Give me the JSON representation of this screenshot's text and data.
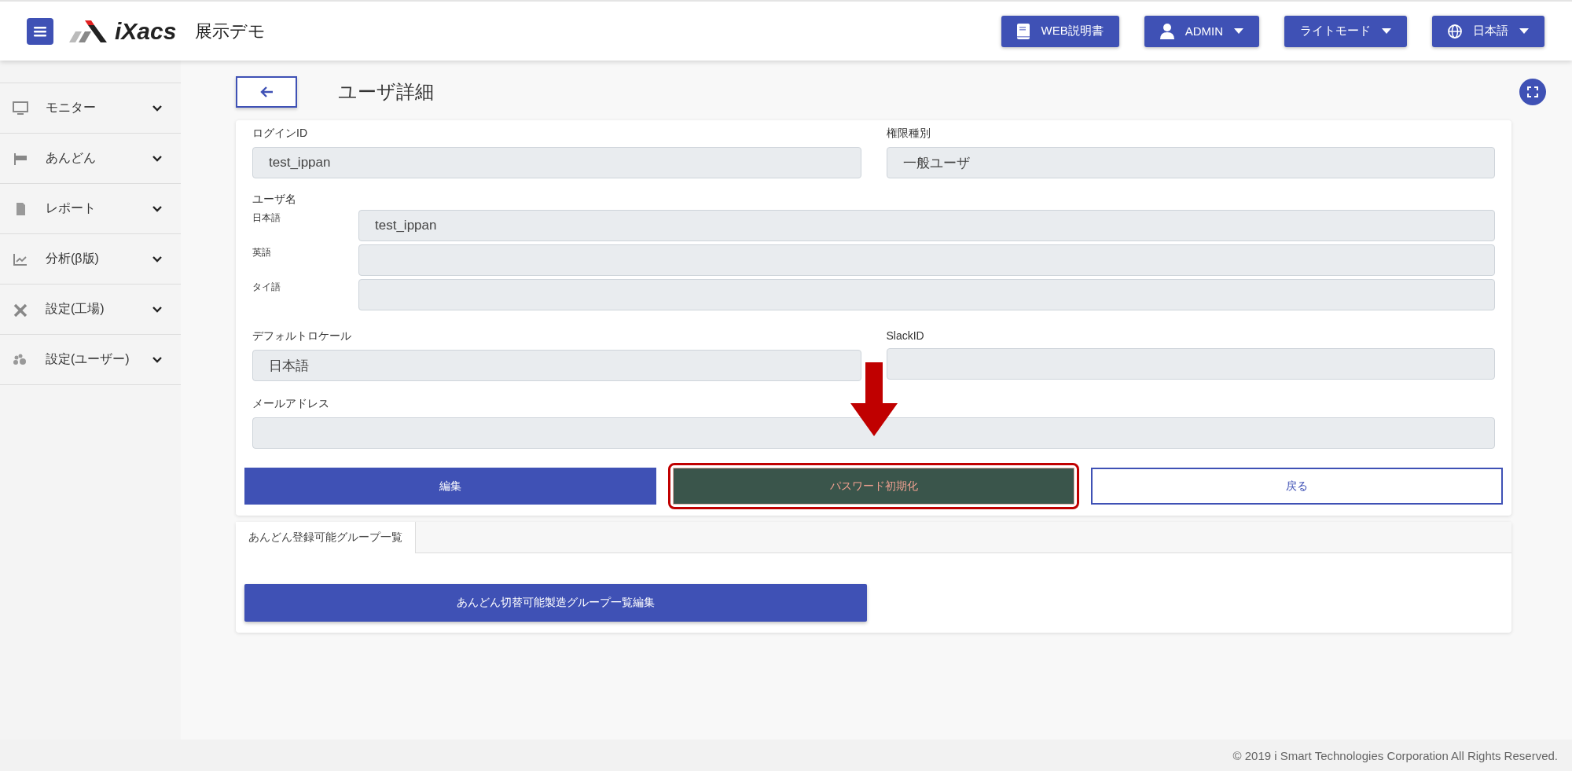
{
  "header": {
    "logo_text": "iXacs",
    "site_name": "展示デモ",
    "buttons": [
      {
        "label": "WEB説明書",
        "kind": "manual",
        "dropdown": false
      },
      {
        "label": "ADMIN",
        "kind": "user",
        "dropdown": true
      },
      {
        "label": "ライトモード",
        "kind": "theme",
        "dropdown": true
      },
      {
        "label": "日本語",
        "kind": "language",
        "dropdown": true
      }
    ]
  },
  "sidebar": {
    "items": [
      {
        "label": "モニター",
        "kind": "monitor"
      },
      {
        "label": "あんどん",
        "kind": "flag"
      },
      {
        "label": "レポート",
        "kind": "report"
      },
      {
        "label": "分析(β版)",
        "kind": "chart"
      },
      {
        "label": "設定(工場)",
        "kind": "tools"
      },
      {
        "label": "設定(ユーザー)",
        "kind": "users"
      }
    ]
  },
  "page": {
    "title": "ユーザ詳細"
  },
  "form": {
    "login_id": {
      "label": "ログインID",
      "value": "test_ippan"
    },
    "role": {
      "label": "権限種別",
      "value": "一般ユーザ"
    },
    "user_name": {
      "label": "ユーザ名",
      "languages": [
        {
          "label": "日本語",
          "value": "test_ippan"
        },
        {
          "label": "英語"
        },
        {
          "label": "タイ語"
        }
      ]
    },
    "locale": {
      "label": "デフォルトロケール",
      "value": "日本語"
    },
    "slack_id": {
      "label": "SlackID"
    },
    "email": {
      "label": "メールアドレス"
    },
    "buttons": [
      {
        "label": "編集",
        "kind": "primary",
        "annotated": false
      },
      {
        "label": "パスワード初期化",
        "kind": "dark",
        "annotated": true
      },
      {
        "label": "戻る",
        "kind": "outline",
        "annotated": false
      }
    ]
  },
  "groups": {
    "tabs": [
      {
        "label": "あんどん登録可能グループ一覧",
        "selected": true
      }
    ],
    "button": "あんどん切替可能製造グループ一覧編集"
  },
  "footer": "© 2019 i Smart Technologies Corporation All Rights Reserved."
}
